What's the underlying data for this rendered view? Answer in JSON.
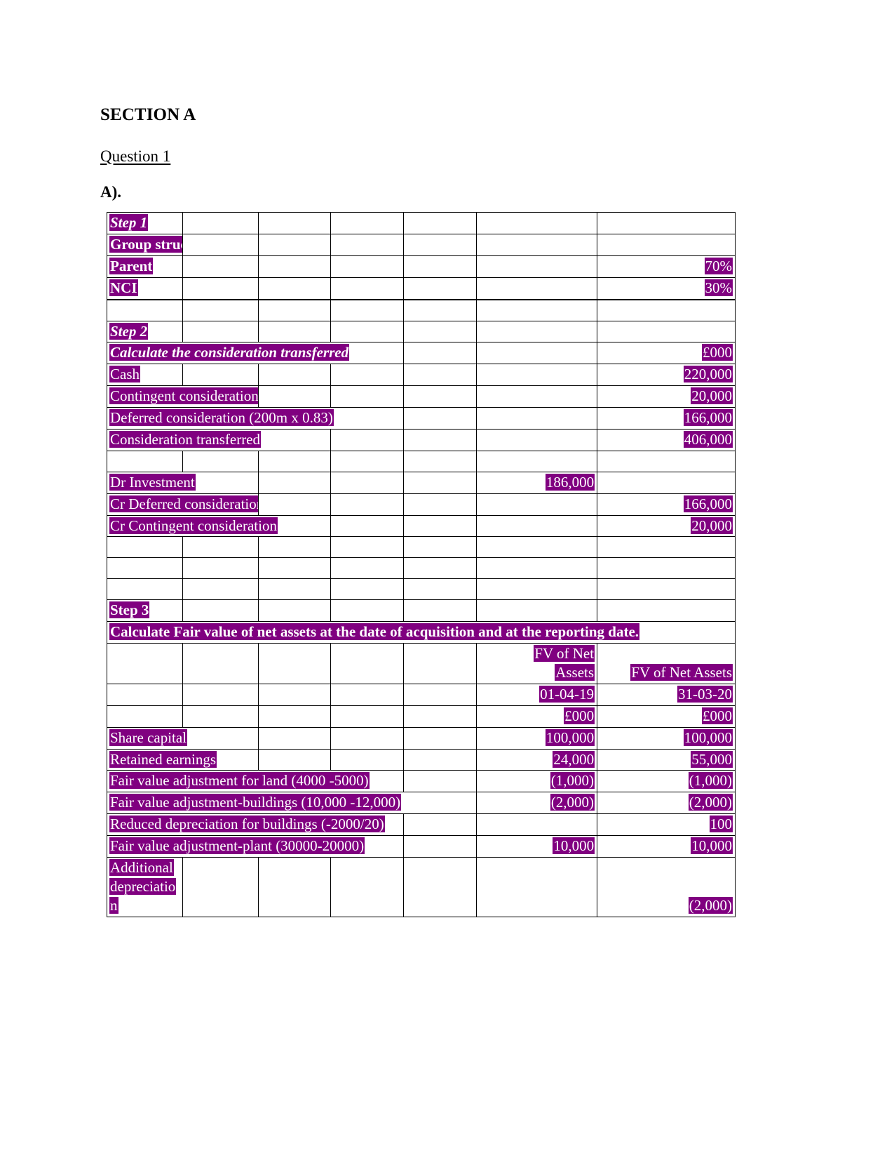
{
  "document": {
    "section_title": "SECTION A",
    "question_label": "Question 1",
    "part_label": "A)."
  },
  "table": {
    "columns": 7,
    "accent_color": "#800080",
    "text_on_accent": "#FFFFFF",
    "rows": [
      {
        "id": "step1",
        "cells": [
          {
            "t": "Step 1",
            "style": "bi",
            "hl": true
          }
        ]
      },
      {
        "id": "group-structure",
        "cells": [
          {
            "t": "Group structure",
            "style": "b",
            "hl": true
          }
        ]
      },
      {
        "id": "parent",
        "cells": [
          {
            "t": "Parent",
            "style": "b",
            "hl": true
          }
        ],
        "last": {
          "t": "70%",
          "hl": true
        }
      },
      {
        "id": "nci",
        "cells": [
          {
            "t": "NCI",
            "style": "b",
            "hl": true
          }
        ],
        "last": {
          "t": "30%",
          "hl": true
        }
      },
      {
        "id": "spacer-1",
        "cells": []
      },
      {
        "id": "step2",
        "cells": [
          {
            "t": "Step 2",
            "style": "bi",
            "hl": true
          }
        ]
      },
      {
        "id": "calc-consideration",
        "cells": [
          {
            "t": "Calculate  the consideration transferred",
            "style": "bi",
            "hl": true
          }
        ],
        "last": {
          "t": "£000",
          "hl": true
        }
      },
      {
        "id": "cash",
        "cells": [
          {
            "t": "Cash",
            "hl": true
          }
        ],
        "last": {
          "t": "220,000",
          "hl": true
        }
      },
      {
        "id": "contingent-consideration",
        "cells": [
          {
            "t": "Contingent consideration",
            "hl": true
          }
        ],
        "last": {
          "t": "20,000",
          "hl": true
        }
      },
      {
        "id": "deferred-consideration",
        "cells": [
          {
            "t": "Deferred consideration (200m x 0.83)",
            "hl": true
          }
        ],
        "last": {
          "t": "166,000",
          "hl": true
        }
      },
      {
        "id": "consideration-transferred",
        "cells": [
          {
            "t": "Consideration transferred",
            "hl": true
          }
        ],
        "last": {
          "t": "406,000",
          "hl": true
        }
      },
      {
        "id": "spacer-2",
        "cells": []
      },
      {
        "id": "dr-investment",
        "cells": [
          {
            "t": "Dr Investment",
            "hl": true
          }
        ],
        "col6": {
          "t": "186,000",
          "hl": true
        }
      },
      {
        "id": "cr-deferred-consideration",
        "cells": [
          {
            "t": "Cr Deferred consideration",
            "hl": true
          }
        ],
        "last": {
          "t": "166,000",
          "hl": true
        }
      },
      {
        "id": "cr-contingent-consideration",
        "cells": [
          {
            "t": "Cr Contingent consideration",
            "hl": true
          }
        ],
        "last": {
          "t": "20,000",
          "hl": true
        }
      },
      {
        "id": "spacer-3",
        "cells": []
      },
      {
        "id": "spacer-4",
        "cells": []
      },
      {
        "id": "spacer-5",
        "cells": []
      },
      {
        "id": "step3",
        "cells": [
          {
            "t": "Step 3",
            "style": "b",
            "hl": true
          }
        ]
      },
      {
        "id": "calc-fv-net-assets",
        "cells": [
          {
            "t": "Calculate Fair value of net assets at the date of acquisition and at the reporting date.",
            "style": "b",
            "hl": true
          }
        ]
      }
    ],
    "step3_header": {
      "fv_col1_line1": "FV of Net",
      "fv_col1_line2": "Assets",
      "fv_col2": "FV of Net Assets",
      "date_col1": "01-04-19",
      "date_col2": "31-03-20",
      "units_col1": "£000",
      "units_col2": "£000"
    },
    "step3_rows": [
      {
        "id": "share-capital",
        "label": "Share capital",
        "v1": "100,000",
        "v2": "100,000"
      },
      {
        "id": "retained-earnings",
        "label": "Retained earnings",
        "v1": "24,000",
        "v2": "55,000"
      },
      {
        "id": "fv-adj-land",
        "label": "Fair value adjustment for land (4000 -5000)",
        "v1": "(1,000)",
        "v2": "(1,000)"
      },
      {
        "id": "fv-adj-buildings",
        "label": "Fair value adjustment-buildings (10,000 -12,000)",
        "v1": "(2,000)",
        "v2": "(2,000)"
      },
      {
        "id": "reduced-depreciation-buildings",
        "label": "Reduced depreciation for buildings (-2000/20)",
        "v1": "",
        "v2": "100"
      },
      {
        "id": "fv-adj-plant",
        "label": "Fair value adjustment-plant (30000-20000)",
        "v1": "10,000",
        "v2": "10,000"
      },
      {
        "id": "additional-depreciation",
        "label": "Additional depreciation",
        "v1": "",
        "v2": "(2,000)"
      }
    ]
  }
}
